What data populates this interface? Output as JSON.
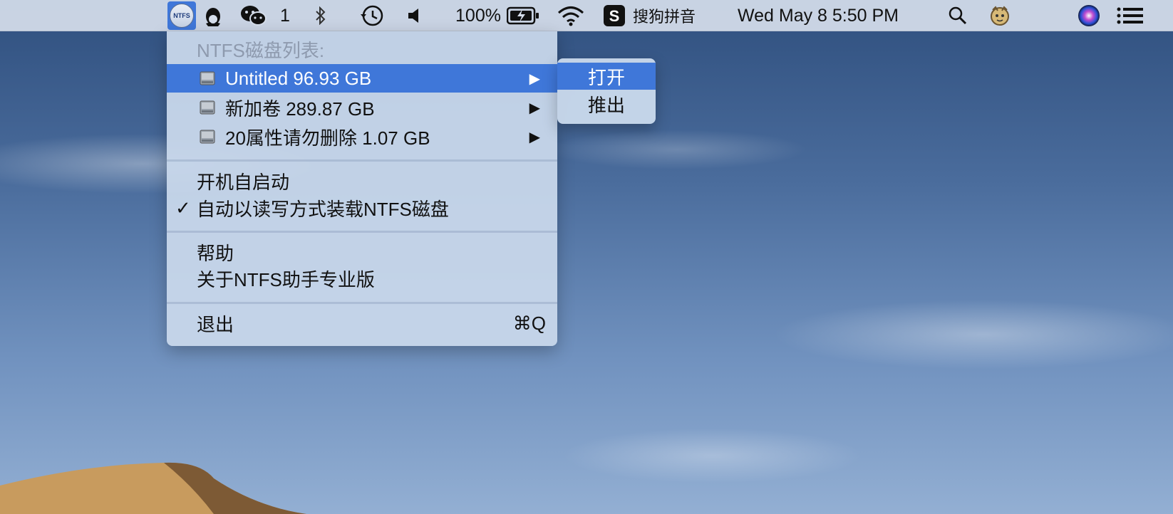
{
  "menubar": {
    "ntfs_logo_text": "NTFS",
    "wechat_badge": "1",
    "battery_percent": "100%",
    "input_method": "搜狗拼音",
    "datetime": "Wed May 8  5:50 PM",
    "icons": [
      "ntfs-app-icon",
      "qq-penguin-icon",
      "wechat-icon",
      "bluetooth-icon",
      "time-machine-icon",
      "volume-icon",
      "battery-charging-icon",
      "wifi-icon",
      "sogou-icon",
      "spotlight-search-icon",
      "avatar-icon",
      "siri-icon",
      "notification-center-icon"
    ]
  },
  "menu": {
    "header": "NTFS磁盘列表:",
    "disks": [
      {
        "label": "Untitled  96.93 GB",
        "selected": true
      },
      {
        "label": "新加卷  289.87 GB",
        "selected": false
      },
      {
        "label": "20属性请勿删除  1.07 GB",
        "selected": false
      }
    ],
    "arrow": "▶",
    "launch_at_login": "开机自启动",
    "auto_mount": "自动以读写方式装载NTFS磁盘",
    "auto_mount_checked": "✓",
    "help": "帮助",
    "about": "关于NTFS助手专业版",
    "quit": "退出",
    "quit_shortcut": "⌘Q"
  },
  "submenu": {
    "items": [
      {
        "label": "打开",
        "selected": true
      },
      {
        "label": "推出",
        "selected": false
      }
    ]
  },
  "colors": {
    "selection": "#3f77d9",
    "menu_bg": "#c9d8eb",
    "header_text": "#8e9aae"
  }
}
